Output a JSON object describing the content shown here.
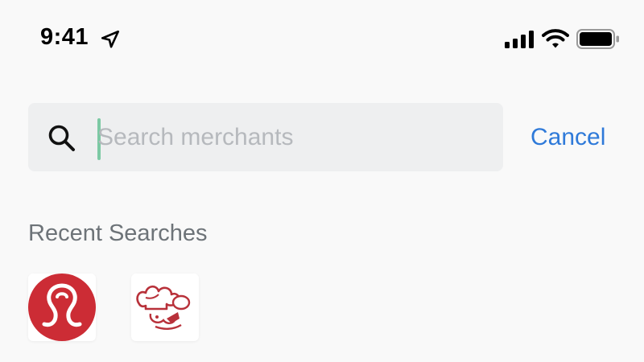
{
  "status_bar": {
    "time": "9:41",
    "icons": [
      "location-arrow-icon",
      "cellular-signal-icon",
      "wifi-icon",
      "battery-icon"
    ]
  },
  "search": {
    "icon": "search-icon",
    "placeholder": "Search merchants",
    "value": "",
    "cancel_label": "Cancel"
  },
  "recent_searches": {
    "title": "Recent Searches",
    "items": [
      {
        "logo": "lululemon-logo"
      },
      {
        "logo": "chef-logo"
      }
    ]
  },
  "colors": {
    "background": "#f9f9f9",
    "search_field": "#eeeff0",
    "accent_link": "#2f7ad9",
    "caret": "#7cc9a4",
    "placeholder": "#b6b9bd",
    "section_title": "#6d7378",
    "logo_red": "#cc2c35"
  }
}
